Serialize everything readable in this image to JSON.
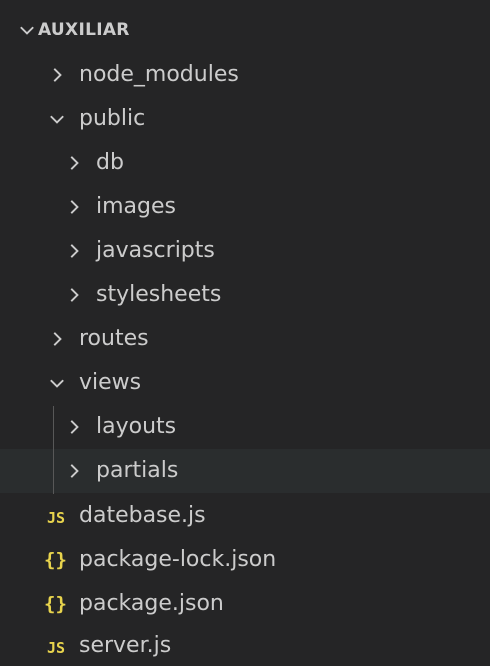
{
  "explorer": {
    "section_title": "AUXILIAR",
    "items": [
      {
        "label": "node_modules",
        "kind": "folder",
        "expanded": false,
        "depth": 1
      },
      {
        "label": "public",
        "kind": "folder",
        "expanded": true,
        "depth": 1
      },
      {
        "label": "db",
        "kind": "folder",
        "expanded": false,
        "depth": 2
      },
      {
        "label": "images",
        "kind": "folder",
        "expanded": false,
        "depth": 2
      },
      {
        "label": "javascripts",
        "kind": "folder",
        "expanded": false,
        "depth": 2
      },
      {
        "label": "stylesheets",
        "kind": "folder",
        "expanded": false,
        "depth": 2
      },
      {
        "label": "routes",
        "kind": "folder",
        "expanded": false,
        "depth": 1
      },
      {
        "label": "views",
        "kind": "folder",
        "expanded": true,
        "depth": 1
      },
      {
        "label": "layouts",
        "kind": "folder",
        "expanded": false,
        "depth": 2
      },
      {
        "label": "partials",
        "kind": "folder",
        "expanded": false,
        "depth": 2,
        "hovered": true
      },
      {
        "label": "datebase.js",
        "kind": "file",
        "icon": "JS",
        "icon_name": "javascript-file-icon",
        "depth": 1
      },
      {
        "label": "package-lock.json",
        "kind": "file",
        "icon": "{}",
        "icon_name": "json-file-icon",
        "depth": 1
      },
      {
        "label": "package.json",
        "kind": "file",
        "icon": "{}",
        "icon_name": "json-file-icon",
        "depth": 1
      },
      {
        "label": "server.js",
        "kind": "file",
        "icon": "JS",
        "icon_name": "javascript-file-icon",
        "depth": 1
      }
    ]
  },
  "colors": {
    "background": "#252526",
    "hover_row": "#2a2d2e",
    "text": "#cccccc",
    "file_icon": "#e8d44d"
  }
}
